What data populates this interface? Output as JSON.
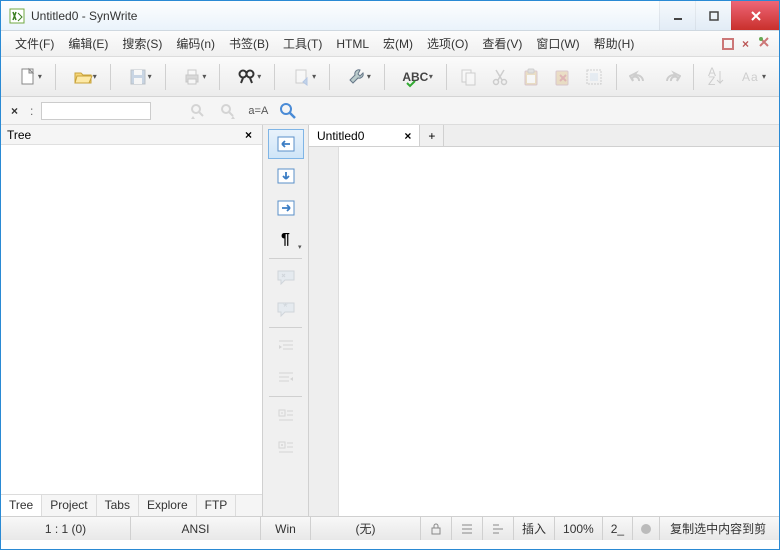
{
  "title": "Untitled0 - SynWrite",
  "menu": [
    "文件(F)",
    "编辑(E)",
    "搜索(S)",
    "编码(n)",
    "书签(B)",
    "工具(T)",
    "HTML",
    "宏(M)",
    "选项(O)",
    "查看(V)",
    "窗口(W)",
    "帮助(H)"
  ],
  "panel": {
    "title": "Tree"
  },
  "bottom_tabs": [
    "Tree",
    "Project",
    "Tabs",
    "Explore",
    "FTP"
  ],
  "editor_tabs": [
    {
      "label": "Untitled0"
    }
  ],
  "status": {
    "pos": "1 : 1 (0)",
    "encoding": "ANSI",
    "lineend": "Win",
    "syntax": "(无)",
    "insert": "插入",
    "zoom": "100%",
    "num": "2_",
    "msg": "复制选中内容到剪"
  },
  "icons": {
    "abc": "ABC",
    "aeqa": "a=A",
    "pilcrow": "¶"
  }
}
